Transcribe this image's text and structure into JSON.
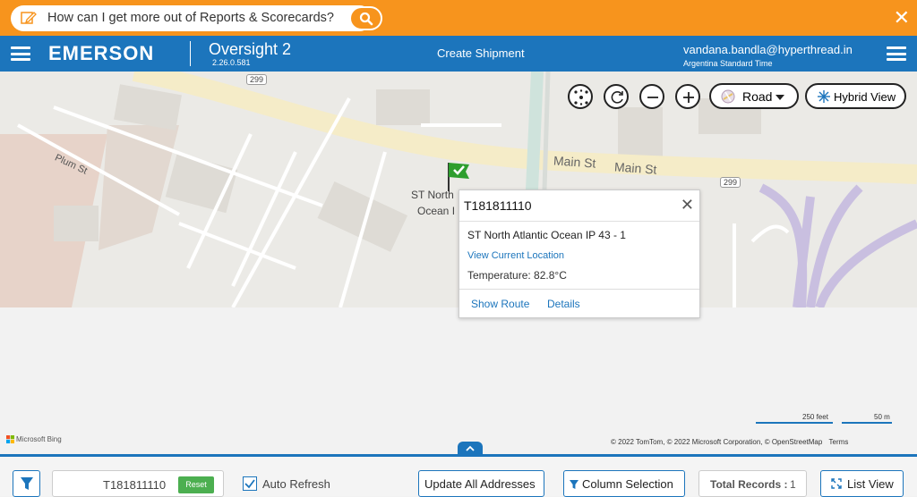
{
  "topbar": {
    "question": "How can I get more out of Reports & Scorecards?",
    "icons": {
      "edit": "edit-icon",
      "search": "search-icon",
      "close": "close-icon"
    }
  },
  "header": {
    "brand": "EMERSON",
    "app_name": "Oversight 2",
    "version": "2.26.0.581",
    "create_shipment": "Create Shipment",
    "user_email": "vandana.bandla@hyperthread.in",
    "timezone": "Argentina Standard Time"
  },
  "map": {
    "controls": {
      "road_label": "Road",
      "hybrid_label": "Hybrid View"
    },
    "labels": {
      "route_shield_1": "299",
      "route_shield_2": "299",
      "street_plum": "Plum St",
      "street_main_1": "Main St",
      "street_main_2": "Main St",
      "pin_label_1": "ST North",
      "pin_label_2": "Ocean I"
    },
    "popup": {
      "title": "T181811110",
      "name": "ST North Atlantic Ocean IP 43 - 1",
      "view_location": "View Current Location",
      "temperature": "Temperature: 82.8°C",
      "show_route": "Show Route",
      "details": "Details"
    },
    "bing": "Microsoft Bing",
    "scale_feet": "250 feet",
    "scale_m": "50 m",
    "copyright": "© 2022 TomTom, © 2022 Microsoft Corporation, © OpenStreetMap",
    "terms": "Terms"
  },
  "bottom": {
    "search_value": "T181811110",
    "reset": "Reset",
    "auto_refresh": "Auto Refresh",
    "update_addresses": "Update All Addresses",
    "column_selection": "Column Selection",
    "total_records_label": "Total Records :",
    "total_records_value": "1",
    "list_view": "List View"
  },
  "colors": {
    "accent": "#1c75bc",
    "topbar": "#f7941d",
    "reset_green": "#4caf50"
  }
}
